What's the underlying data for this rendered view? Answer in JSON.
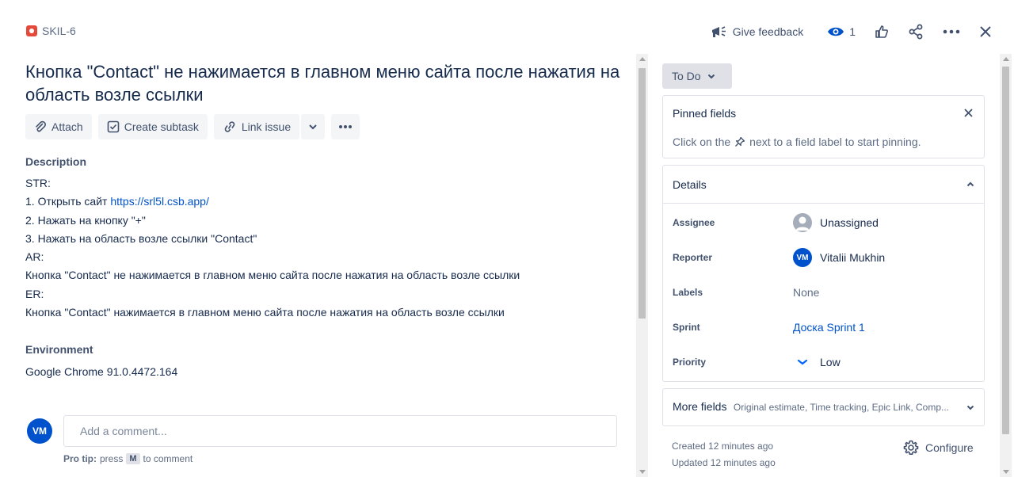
{
  "header": {
    "issue_key": "SKIL-6",
    "feedback_label": "Give feedback",
    "watch_count": "1"
  },
  "issue": {
    "title": "Кнопка \"Contact\" не нажимается в главном меню сайта после нажатия на область возле ссылки",
    "toolbar": {
      "attach": "Attach",
      "create_subtask": "Create subtask",
      "link_issue": "Link issue"
    },
    "description_label": "Description",
    "description": {
      "line1": "STR:",
      "line2_prefix": "1. Открыть сайт ",
      "line2_link": "https://srl5l.csb.app/",
      "line3": "2. Нажать на кнопку \"+\"",
      "line4": "3. Нажать на область возле ссылки \"Contact\"",
      "line5": "AR:",
      "line6": "Кнопка \"Contact\" не нажимается в главном меню сайта после нажатия на область возле ссылки",
      "line7": "ER:",
      "line8": "Кнопка \"Contact\" нажимается в главном меню сайта после нажатия на область возле ссылки"
    },
    "environment_label": "Environment",
    "environment_value": "Google Chrome 91.0.4472.164"
  },
  "comment": {
    "avatar_initials": "VM",
    "placeholder": "Add a comment...",
    "protip_label": "Pro tip:",
    "protip_press": "press",
    "protip_key": "M",
    "protip_suffix": "to comment"
  },
  "sidebar": {
    "status": "To Do",
    "pinned": {
      "title": "Pinned fields",
      "hint_prefix": "Click on the",
      "hint_suffix": "next to a field label to start pinning."
    },
    "details": {
      "title": "Details",
      "fields": [
        {
          "label": "Assignee",
          "value": "Unassigned"
        },
        {
          "label": "Reporter",
          "value": "Vitalii Mukhin",
          "initials": "VM"
        },
        {
          "label": "Labels",
          "value": "None"
        },
        {
          "label": "Sprint",
          "value": "Доска Sprint 1"
        },
        {
          "label": "Priority",
          "value": "Low"
        }
      ]
    },
    "more_fields": {
      "title": "More fields",
      "subtitle": "Original estimate, Time tracking, Epic Link, Comp..."
    },
    "created": "Created 12 minutes ago",
    "updated": "Updated 12 minutes ago",
    "configure": "Configure"
  },
  "colors": {
    "accent": "#0052cc",
    "bug": "#e5493a",
    "priority_low": "#0065ff"
  }
}
